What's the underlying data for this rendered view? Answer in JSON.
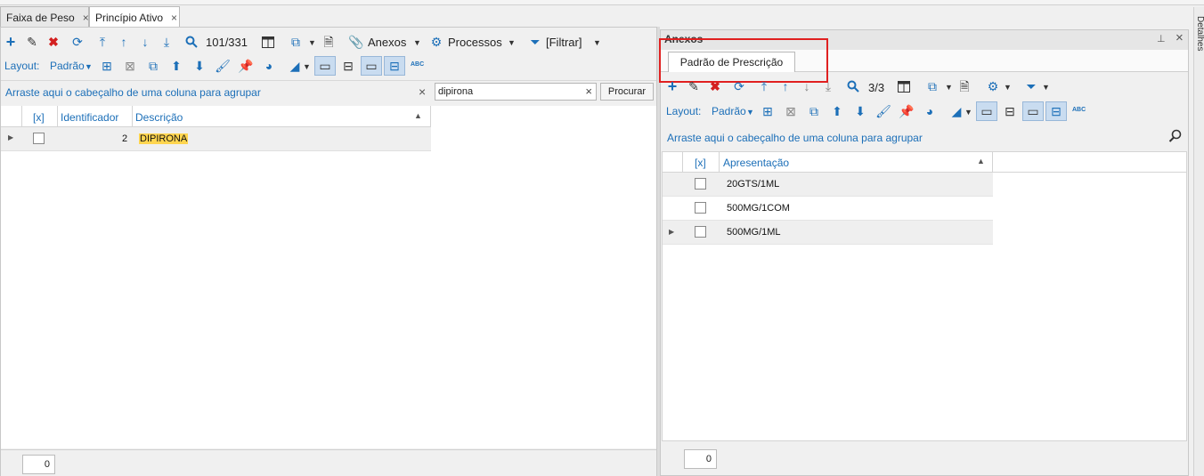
{
  "tabs": [
    {
      "label": "Faixa de Peso",
      "close": "×"
    },
    {
      "label": "Princípio Ativo",
      "close": "×"
    }
  ],
  "left": {
    "toolbar": {
      "record_counter": "101/331",
      "anexos_label": "Anexos",
      "processos_label": "Processos",
      "filtrar_label": "[Filtrar]"
    },
    "layout_label": "Layout:",
    "layout_value": "Padrão",
    "group_hint": "Arraste aqui o cabeçalho de uma coluna para agrupar",
    "search": {
      "value": "dipirona",
      "clear": "×",
      "button_label": "Procurar"
    },
    "grid": {
      "headers": {
        "check": "[x]",
        "id": "Identificador",
        "desc": "Descrição"
      },
      "rows": [
        {
          "id": "2",
          "desc": "DIPIRONA"
        }
      ]
    },
    "footer_count": "0"
  },
  "right": {
    "title": "Anexos",
    "pin_icon": "pin-icon",
    "close_icon": "×",
    "subtab_label": "Padrão de Prescrição",
    "toolbar": {
      "record_counter": "3/3"
    },
    "layout_label": "Layout:",
    "layout_value": "Padrão",
    "group_hint": "Arraste aqui o cabeçalho de uma coluna para agrupar",
    "grid": {
      "headers": {
        "check": "[x]",
        "apresentacao": "Apresentação"
      },
      "rows": [
        {
          "value": "20GTS/1ML"
        },
        {
          "value": "500MG/1COM"
        },
        {
          "value": "500MG/1ML"
        }
      ]
    },
    "footer_count": "0"
  },
  "side_tab_label": "Detalhes",
  "colors": {
    "accent": "#1c6fb8",
    "highlight": "#ffd54f",
    "annotation_box": "#e02020",
    "toggle_active": "#c9dcf0"
  }
}
